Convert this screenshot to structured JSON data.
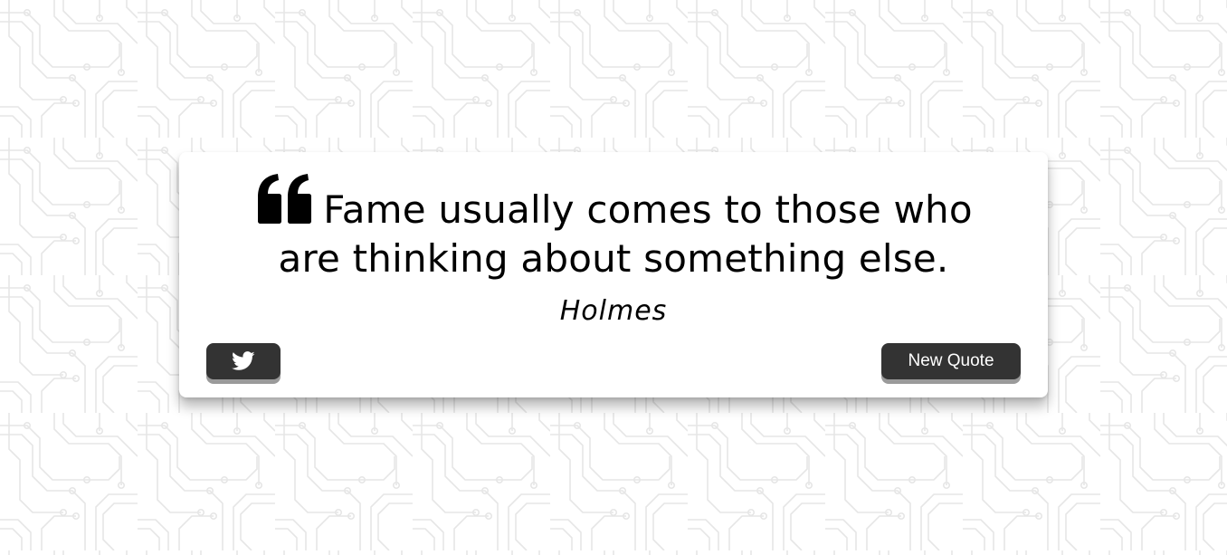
{
  "quote": {
    "icon": "quote-left-icon",
    "text": "Fame usually comes to those who are thinking about something else.",
    "author": "Holmes"
  },
  "actions": {
    "tweet_icon": "twitter-icon",
    "new_quote_label": "New Quote"
  },
  "colors": {
    "background": "#ffffff",
    "pattern": "#e9e9e9",
    "card": "#ffffff",
    "button": "#333333",
    "button_shadow": "#9a9a9a",
    "text": "#000000"
  }
}
